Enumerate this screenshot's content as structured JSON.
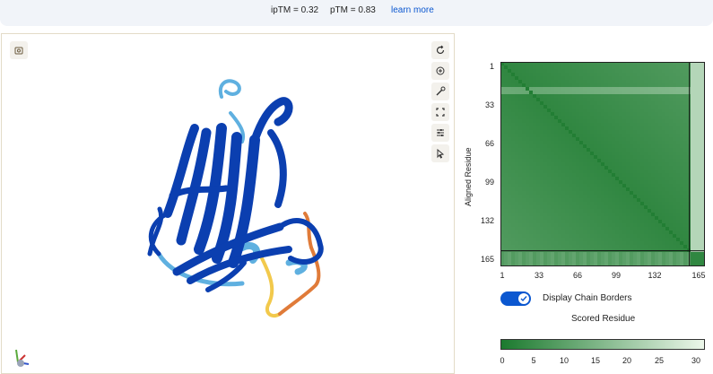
{
  "header": {
    "iptm": "ipTM = 0.32",
    "ptm": "pTM = 0.83",
    "learn_more": "learn more"
  },
  "viewer": {
    "icons": [
      "screenshot-icon",
      "rotate-icon",
      "zoom-icon",
      "measure-icon",
      "fullscreen-icon",
      "settings-icon",
      "pointer-icon"
    ],
    "colors": {
      "very_high": "#0b3fb0",
      "confident": "#5fb0e0",
      "low": "#f2c94c",
      "very_low": "#e07b39"
    }
  },
  "pae": {
    "y_axis_title": "Aligned Residue",
    "x_axis_title": "Scored Residue",
    "toggle_label": "Display Chain Borders",
    "toggle_on": true,
    "colorbar_ticks": [
      "0",
      "5",
      "10",
      "15",
      "20",
      "25",
      "30"
    ],
    "colorbar_colors": {
      "low": "#1b7a2e",
      "high": "#ecf7ea"
    }
  },
  "chart_data": {
    "type": "heatmap",
    "title": "",
    "xlabel": "Scored Residue",
    "ylabel": "Aligned Residue",
    "x_ticks": [
      "1",
      "33",
      "66",
      "99",
      "132",
      "165"
    ],
    "y_ticks": [
      "1",
      "33",
      "66",
      "99",
      "132",
      "165"
    ],
    "x_range": [
      1,
      171
    ],
    "y_range": [
      1,
      171
    ],
    "chain_border_at": 158,
    "value_range": [
      0,
      30
    ],
    "colorbar_ticks": [
      0,
      5,
      10,
      15,
      20,
      25,
      30
    ],
    "pattern": {
      "chain_A_within": 3,
      "diagonal": 1,
      "chain_A_to_chain_B": 22,
      "chain_B_to_chain_A": 8,
      "chain_B_within": 3
    }
  }
}
